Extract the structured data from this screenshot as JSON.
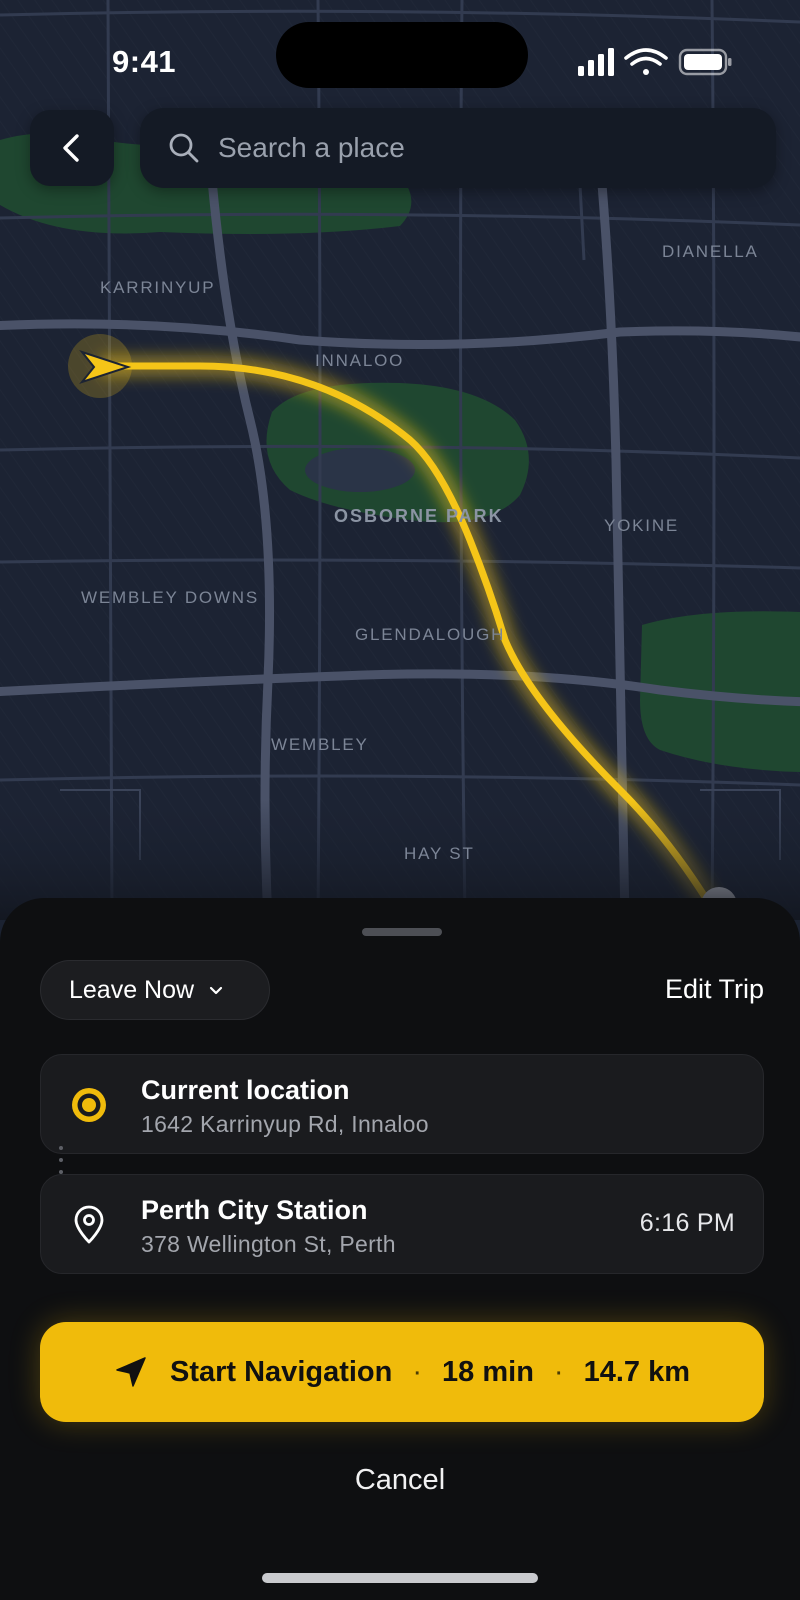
{
  "status_bar": {
    "time": "9:41",
    "icons": [
      "cellular-signal-icon",
      "wifi-icon",
      "battery-icon"
    ]
  },
  "search": {
    "placeholder": "Search a place",
    "value": ""
  },
  "map": {
    "labels": {
      "dianella": "DIANELLA",
      "karrinyup": "KARRINYUP",
      "innaloo": "INNALOO",
      "osborne_park": "OSBORNE PARK",
      "yokine": "YOKINE",
      "wembley_downs": "WEMBLEY DOWNS",
      "glendalough": "GLENDALOUGH",
      "wembley": "WEMBLEY",
      "hay_st": "HAY ST"
    },
    "route_color": "#f5c518",
    "park_color": "#1f4730",
    "road_color": "#4a5268"
  },
  "trip": {
    "departure_label": "Leave Now",
    "edit_label": "Edit Trip",
    "origin": {
      "title": "Current location",
      "address": "1642 Karrinyup Rd, Innaloo"
    },
    "destination": {
      "title": "Perth City Station",
      "address": "378 Wellington St, Perth",
      "eta": "6:16 PM"
    }
  },
  "actions": {
    "start_label": "Start Navigation",
    "duration": "18 min",
    "distance": "14.7 km",
    "separator": "·",
    "cancel_label": "Cancel"
  },
  "colors": {
    "accent": "#f0bb0b",
    "sheet_bg": "#0e0f11",
    "card_bg": "#1a1b1e"
  }
}
